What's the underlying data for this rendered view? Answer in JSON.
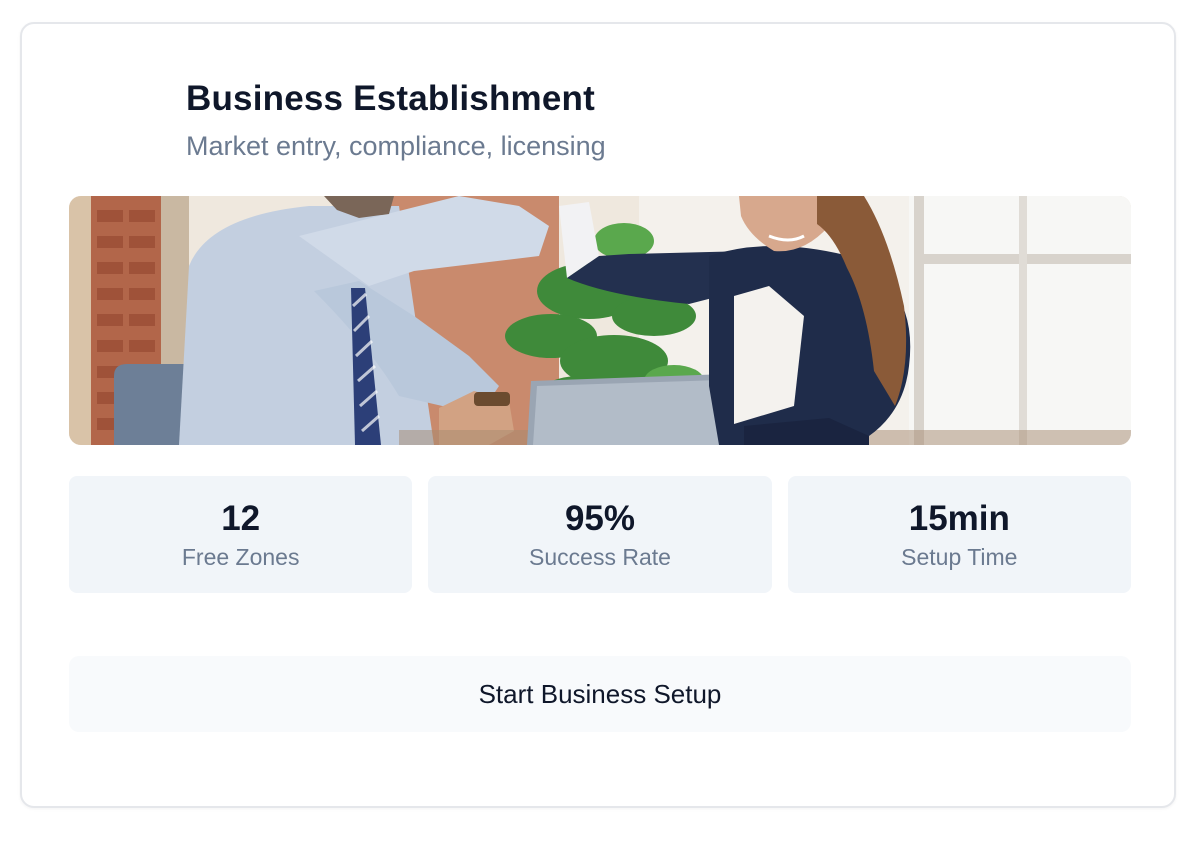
{
  "card": {
    "title": "Business Establishment",
    "subtitle": "Market entry, compliance, licensing"
  },
  "stats": [
    {
      "value": "12",
      "label": "Free Zones"
    },
    {
      "value": "95%",
      "label": "Success Rate"
    },
    {
      "value": "15min",
      "label": "Setup Time"
    }
  ],
  "cta": {
    "label": "Start Business Setup"
  },
  "colors": {
    "title": "#0f172a",
    "muted": "#6b7a90",
    "stat_bg": "#f1f5f9",
    "button_bg": "#f8fafc",
    "border": "#e5e7eb"
  },
  "image": {
    "subject": "two business people high-fiving across a desk with a laptop"
  }
}
